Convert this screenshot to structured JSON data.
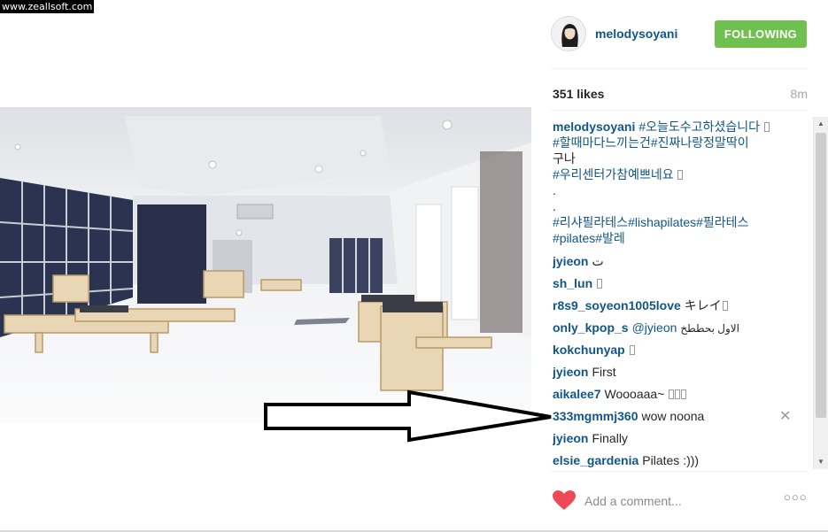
{
  "watermark": "www.zeallsoft.com",
  "post": {
    "username": "melodysoyani",
    "follow_label": "FOLLOWING",
    "likes": "351 likes",
    "time_ago": "8m"
  },
  "caption": {
    "author": "melodysoyani",
    "line1": "#오늘도수고하셨습니다",
    "line2": "#할때마다느끼는건#진짜나랑정말딱이",
    "line3": "구나",
    "line4": "#우리센터가참예쁘네요",
    "line5": ".",
    "line6": ".",
    "line7": "#리샤필라테스#lishapilates#필라테스",
    "line8": "#pilates#발레"
  },
  "comments": [
    {
      "author": "jyieon",
      "text": "ت"
    },
    {
      "author": "sh_lun",
      "text": ""
    },
    {
      "author": "r8s9_soyeon1005love",
      "text": "キレイ"
    },
    {
      "author": "only_kpop_s",
      "mention": "@jyieon",
      "text": "الاول بحططخ"
    },
    {
      "author": "kokchunyap",
      "text": ""
    },
    {
      "author": "jyieon",
      "text": "First"
    },
    {
      "author": "aikalee7",
      "text": "Woooaaa~"
    },
    {
      "author": "333mgmmj360",
      "text": "wow noona"
    },
    {
      "author": "jyieon",
      "text": "Finally"
    },
    {
      "author": "elsie_gardenia",
      "text": "Pilates :)))"
    }
  ],
  "comment_input": {
    "placeholder": "Add a comment..."
  },
  "icons": {
    "heart": "heart-icon",
    "more": "more-options-icon",
    "delete": "delete-comment-icon",
    "avatar": "profile-avatar"
  },
  "colors": {
    "link_blue": "#125688",
    "follow_green": "#70c050",
    "heart_red": "#ed4956"
  }
}
